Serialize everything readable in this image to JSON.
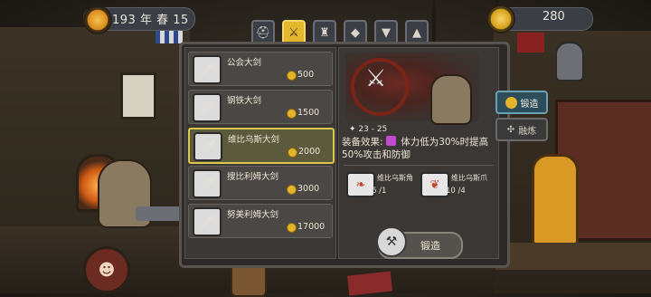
{
  "header": {
    "date": "193 年 春 15",
    "coins": "280"
  },
  "tabs": [
    {
      "icon": "helmet-icon",
      "glyph": "⛑",
      "active": false
    },
    {
      "icon": "sword-hand-icon",
      "glyph": "⚔",
      "active": true
    },
    {
      "icon": "helmet-horned-icon",
      "glyph": "♜",
      "active": false
    },
    {
      "icon": "shield-icon",
      "glyph": "◆",
      "active": false
    },
    {
      "icon": "armor-icon",
      "glyph": "▼",
      "active": false
    },
    {
      "icon": "boots-icon",
      "glyph": "▲",
      "active": false
    }
  ],
  "weapons": [
    {
      "name": "公会大剑",
      "price": "500",
      "selected": false,
      "glyph": "🗡"
    },
    {
      "name": "钢铁大剑",
      "price": "1500",
      "selected": false,
      "glyph": "🗡"
    },
    {
      "name": "维比乌斯大剑",
      "price": "2000",
      "selected": true,
      "glyph": "🗡"
    },
    {
      "name": "搜比利姆大剑",
      "price": "3000",
      "selected": false,
      "glyph": "🗡"
    },
    {
      "name": "努美利姆大剑",
      "price": "17000",
      "selected": false,
      "glyph": "🗡"
    }
  ],
  "detail": {
    "damage": "23 - 25",
    "effect_label": "装备效果:",
    "effect_text": "体力低为30%时提高50%攻击和防御",
    "materials": [
      {
        "name": "维比乌斯角",
        "count": "6 /1",
        "glyph": "❧"
      },
      {
        "name": "维比乌斯爪",
        "count": "10 /4",
        "glyph": "❦"
      }
    ],
    "forge_label": "锻造"
  },
  "side": {
    "forge": "锻造",
    "fuse": "融炼"
  },
  "colors": {
    "accent": "#e3b72e",
    "selected_border": "#d9c84a",
    "side_forge_bg": "#2e4d5a"
  }
}
